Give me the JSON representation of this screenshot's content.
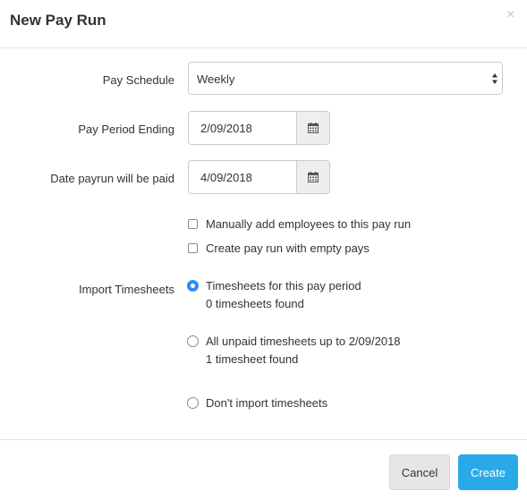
{
  "dialog": {
    "title": "New Pay Run",
    "close_label": "×"
  },
  "form": {
    "pay_schedule": {
      "label": "Pay Schedule",
      "value": "Weekly"
    },
    "pay_period_ending": {
      "label": "Pay Period Ending",
      "value": "2/09/2018"
    },
    "date_paid": {
      "label": "Date payrun will be paid",
      "value": "4/09/2018"
    },
    "checkboxes": [
      {
        "label": "Manually add employees to this pay run",
        "checked": false
      },
      {
        "label": "Create pay run with empty pays",
        "checked": false
      }
    ],
    "import_timesheets": {
      "label": "Import Timesheets",
      "options": [
        {
          "label": "Timesheets for this pay period",
          "sub": "0 timesheets found",
          "selected": true
        },
        {
          "label": "All unpaid timesheets up to 2/09/2018",
          "sub": "1 timesheet found",
          "selected": false
        },
        {
          "label": "Don't import timesheets",
          "selected": false
        }
      ]
    }
  },
  "footer": {
    "cancel_label": "Cancel",
    "create_label": "Create"
  },
  "icons": {
    "calendar": "calendar-icon",
    "select_arrows": "updown-arrows-icon",
    "close": "close-icon"
  },
  "colors": {
    "primary": "#2aa9e8",
    "radio_selected": "#2d8ef0",
    "cancel_bg": "#e6e6e6",
    "addon_bg": "#eeeeee"
  }
}
